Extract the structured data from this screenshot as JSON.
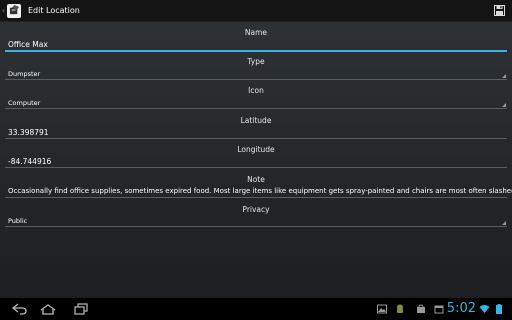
{
  "header": {
    "title": "Edit Location"
  },
  "fields": {
    "name": {
      "label": "Name",
      "value": "Office Max"
    },
    "type": {
      "label": "Type",
      "value": "Dumpster"
    },
    "icon": {
      "label": "Icon",
      "value": "Computer"
    },
    "latitude": {
      "label": "Latitude",
      "value": "33.398791"
    },
    "longitude": {
      "label": "Longitude",
      "value": "-84.744916"
    },
    "note": {
      "label": "Note",
      "value": "Occasionally find office supplies, sometimes expired food. Most large items like equipment gets spray-painted and chairs are most often slashed."
    },
    "privacy": {
      "label": "Privacy",
      "value": "Public"
    }
  },
  "status": {
    "time": "5:02"
  },
  "colors": {
    "accent": "#33b5e5",
    "background": "#25282b"
  },
  "icons": [
    "app-icon",
    "save-icon",
    "back-icon",
    "home-icon",
    "recent-apps-icon",
    "gallery-icon",
    "android-icon",
    "store-icon",
    "calendar-icon",
    "briefcase-icon",
    "wifi-icon",
    "battery-icon"
  ]
}
